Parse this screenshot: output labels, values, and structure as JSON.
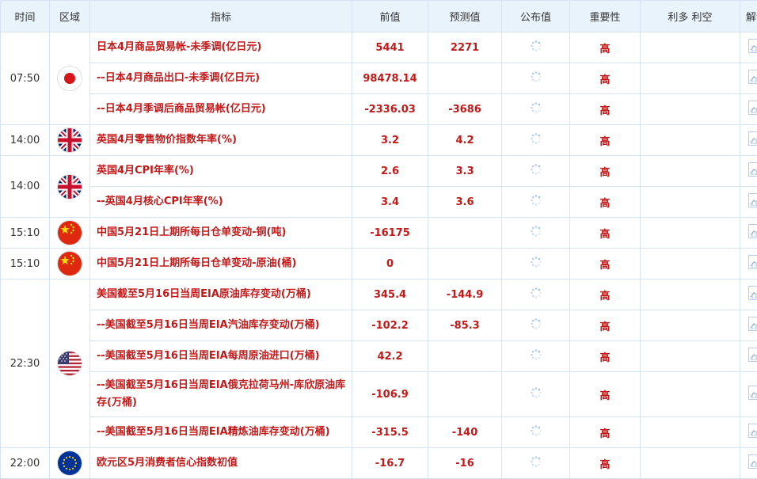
{
  "header": {
    "time": "时间",
    "region": "区域",
    "indicator": "指标",
    "previous": "前值",
    "forecast": "预测值",
    "actual": "公布值",
    "importance": "重要性",
    "impact": "利多 利空",
    "interpret": "解读"
  },
  "rows": [
    {
      "time": "07:50",
      "indicator": "日本4月商品贸易帐-未季调(亿日元)",
      "previous": "5441",
      "forecast": "2271",
      "importance": "高"
    },
    {
      "indicator": "--日本4月商品出口-未季调(亿日元)",
      "previous": "98478.14",
      "forecast": "",
      "importance": "高"
    },
    {
      "indicator": "--日本4月季调后商品贸易帐(亿日元)",
      "previous": "-2336.03",
      "forecast": "-3686",
      "importance": "高"
    },
    {
      "time": "14:00",
      "indicator": "英国4月零售物价指数年率(%)",
      "previous": "3.2",
      "forecast": "4.2",
      "importance": "高"
    },
    {
      "time": "14:00",
      "indicator": "英国4月CPI年率(%)",
      "previous": "2.6",
      "forecast": "3.3",
      "importance": "高"
    },
    {
      "indicator": "--英国4月核心CPI年率(%)",
      "previous": "3.4",
      "forecast": "3.6",
      "importance": "高"
    },
    {
      "time": "15:10",
      "indicator": "中国5月21日上期所每日仓单变动-铜(吨)",
      "previous": "-16175",
      "forecast": "",
      "importance": "高"
    },
    {
      "time": "15:10",
      "indicator": "中国5月21日上期所每日仓单变动-原油(桶)",
      "previous": "0",
      "forecast": "",
      "importance": "高"
    },
    {
      "time": "22:30",
      "indicator": "美国截至5月16日当周EIA原油库存变动(万桶)",
      "previous": "345.4",
      "forecast": "-144.9",
      "importance": "高"
    },
    {
      "indicator": "--美国截至5月16日当周EIA汽油库存变动(万桶)",
      "previous": "-102.2",
      "forecast": "-85.3",
      "importance": "高"
    },
    {
      "indicator": "--美国截至5月16日当周EIA每周原油进口(万桶)",
      "previous": "42.2",
      "forecast": "",
      "importance": "高"
    },
    {
      "indicator": "--美国截至5月16日当周EIA俄克拉荷马州-库欣原油库存(万桶)",
      "previous": "-106.9",
      "forecast": "",
      "importance": "高"
    },
    {
      "indicator": "--美国截至5月16日当周EIA精炼油库存变动(万桶)",
      "previous": "-315.5",
      "forecast": "-140",
      "importance": "高"
    },
    {
      "time": "22:00",
      "indicator": "欧元区5月消费者信心指数初值",
      "previous": "-16.7",
      "forecast": "-16",
      "importance": "高"
    }
  ],
  "flags": [
    "japan-flag",
    "uk-flag",
    "uk-flag",
    "china-flag",
    "china-flag",
    "us-flag",
    "eu-flag"
  ],
  "icons": {
    "actual": "loading-spinner-icon",
    "interpret": "chart-analysis-icon"
  },
  "colors": {
    "text_red": "#c21a1a",
    "header_bg": "#e9f3fc",
    "border": "#d5e3f2"
  }
}
